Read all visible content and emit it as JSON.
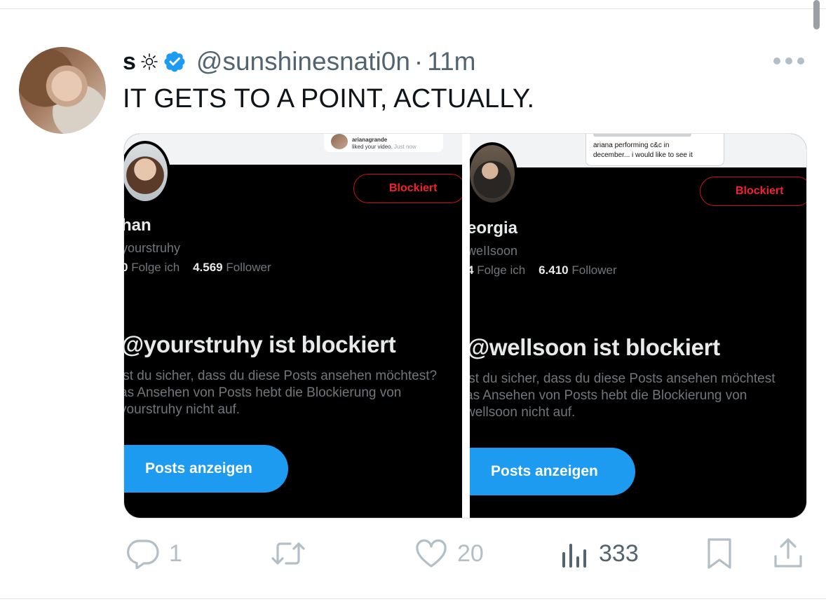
{
  "tweet": {
    "author_name": "s",
    "handle": "@sunshinesnati0n",
    "separator": "·",
    "time": "11m",
    "text": "IT GETS TO A POINT, ACTUALLY."
  },
  "media": {
    "left": {
      "notif_user": "arianagrande",
      "notif_text": "liked your video.",
      "notif_time": "Just now",
      "blocked_label": "Blockiert",
      "name": "han",
      "handle": "yourstruhy",
      "following_count": "0",
      "following_label": "Folge ich",
      "followers_count": "4.569",
      "followers_label": "Follower",
      "blocked_title": "@yourstruhy ist blockiert",
      "line1": "ist du sicher, dass du diese Posts ansehen möchtest?",
      "line2": "as Ansehen von Posts hebt die Blockierung von",
      "line3": "yourstruhy nicht auf.",
      "button": "Posts anzeigen"
    },
    "right": {
      "dm_line1": "ariana performing c&c in",
      "dm_line2": "december... i would like to see it",
      "blocked_label": "Blockiert",
      "name": "eorgia",
      "handle": "weIIsoon",
      "following_count": "4",
      "following_label": "Folge ich",
      "followers_count": "6.410",
      "followers_label": "Follower",
      "blocked_title": "@wellsoon ist blockiert",
      "line1": "ist du sicher, dass du diese Posts ansehen möchtest",
      "line2": "as Ansehen von Posts hebt die Blockierung von",
      "line3": "wellsoon nicht auf.",
      "button": "Posts anzeigen"
    }
  },
  "actions": {
    "replies": "1",
    "retweets": "",
    "likes": "20",
    "views": "333"
  },
  "colors": {
    "verified": "#1d9bf0",
    "blocked": "#f4212e",
    "button": "#1d9bf0",
    "muted_icon": "#b4bec6"
  }
}
